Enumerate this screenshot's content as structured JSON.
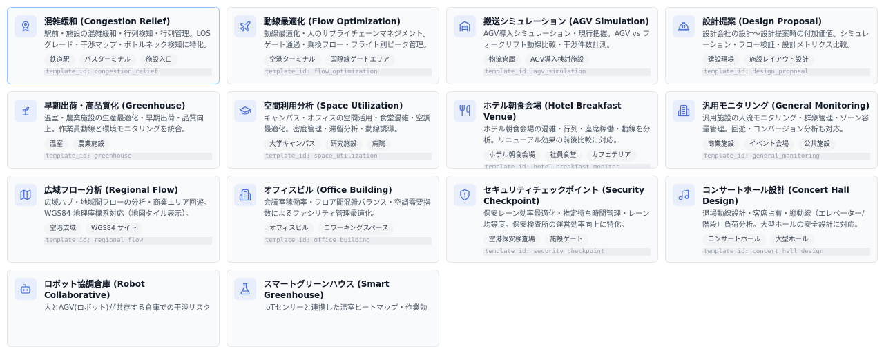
{
  "accent_color": "#4f74d9",
  "templates": [
    {
      "icon": "user-badge-icon",
      "title": "混雑緩和 (Congestion Relief)",
      "desc": "駅前・施設の混雑緩和・行列検知・行列管理。LOSグレード・干渉マップ・ボトルネック検知に特化。",
      "tags": [
        "鉄道駅",
        "バスターミナル",
        "施設入口"
      ],
      "template_id": "template_id: congestion_relief"
    },
    {
      "icon": "airplane-icon",
      "title": "動線最適化 (Flow Optimization)",
      "desc": "動線最適化・人のサプライチェーンマネジメント。ゲート通過・乗換フロー・フライト別ピーク管理。",
      "tags": [
        "空港ターミナル",
        "国際線ゲートエリア"
      ],
      "template_id": "template_id: flow_optimization"
    },
    {
      "icon": "warehouse-icon",
      "title": "搬送シミュレーション (AGV Simulation)",
      "desc": "AGV導入シミュレーション・現行把握。AGV vs フォークリフト動線比較・干渉件数計測。",
      "tags": [
        "物流倉庫",
        "AGV導入検討施設"
      ],
      "template_id": "template_id: agv_simulation"
    },
    {
      "icon": "hard-hat-icon",
      "title": "設計提案 (Design Proposal)",
      "desc": "設計会社の設計〜設計提案時の付加価値。シミュレーション・フロー検証・設計メトリクス比較。",
      "tags": [
        "建設現場",
        "施設レイアウト設計"
      ],
      "template_id": "template_id: design_proposal"
    },
    {
      "icon": "sprout-icon",
      "title": "早期出荷・高品質化 (Greenhouse)",
      "desc": "温室・農業施設の生産最適化・早期出荷・品質向上。作業員動線と環境モニタリングを統合。",
      "tags": [
        "温室",
        "農業施設"
      ],
      "template_id": "template_id: greenhouse"
    },
    {
      "icon": "graduation-cap-icon",
      "title": "空間利用分析 (Space Utilization)",
      "desc": "キャンパス・オフィスの空間活用・食堂混雑・空調最適化。密度管理・滞留分析・動線誘導。",
      "tags": [
        "大学キャンパス",
        "研究施設",
        "病院"
      ],
      "template_id": "template_id: space_utilization"
    },
    {
      "icon": "utensils-icon",
      "title": "ホテル朝食会場 (Hotel Breakfast Venue)",
      "desc": "ホテル朝食会場の混雑・行列・座席稼働・動線を分析。リニューアル効果の前後比較に対応。",
      "tags": [
        "ホテル朝食会場",
        "社員食堂",
        "カフェテリア"
      ],
      "template_id": "template_id: hotel_breakfast_monitor"
    },
    {
      "icon": "building-icon",
      "title": "汎用モニタリング (General Monitoring)",
      "desc": "汎用施設の人流モニタリング・群衆管理・ゾーン容量管理。回遊・コンバージョン分析も対応。",
      "tags": [
        "商業施設",
        "イベント会場",
        "公共施設"
      ],
      "template_id": "template_id: general_monitoring"
    },
    {
      "icon": "map-icon",
      "title": "広域フロー分析 (Regional Flow)",
      "desc": "広域ハブ・地域間フローの分析・商業エリア回遊。WGS84 地理座標系対応（地図タイル表示）。",
      "tags": [
        "空港広域",
        "WGS84 サイト"
      ],
      "template_id": "template_id: regional_flow"
    },
    {
      "icon": "office-building-icon",
      "title": "オフィスビル (Office Building)",
      "desc": "会議室稼働率・フロア間混雑バランス・空調需要指数によるファシリティ管理最適化。",
      "tags": [
        "オフィスビル",
        "コワーキングスペース"
      ],
      "template_id": "template_id: office_building"
    },
    {
      "icon": "shield-icon",
      "title": "セキュリティチェックポイント (Security Checkpoint)",
      "desc": "保安レーン効率最適化・推定待ち時間管理・レーン均等度。保安検査所の運営効率向上に特化。",
      "tags": [
        "空港保安検査場",
        "施設ゲート"
      ],
      "template_id": "template_id: security_checkpoint"
    },
    {
      "icon": "music-note-icon",
      "title": "コンサートホール設計 (Concert Hall Design)",
      "desc": "退場動線設計・客席占有・縦動線（エレベーター/階段）負荷分析。大型ホールの安全設計に対応。",
      "tags": [
        "コンサートホール",
        "大型ホール"
      ],
      "template_id": "template_id: concert_hall_design"
    },
    {
      "icon": "robot-icon",
      "title": "ロボット協調倉庫 (Robot Collaborative)",
      "desc": "人とAGV(ロボット)が共存する倉庫での干渉リスク",
      "tags": [],
      "template_id": ""
    },
    {
      "icon": "flask-icon",
      "title": "スマートグリーンハウス (Smart Greenhouse)",
      "desc": "IoTセンサーと連携した温室ヒートマップ・作業効",
      "tags": [],
      "template_id": ""
    }
  ]
}
